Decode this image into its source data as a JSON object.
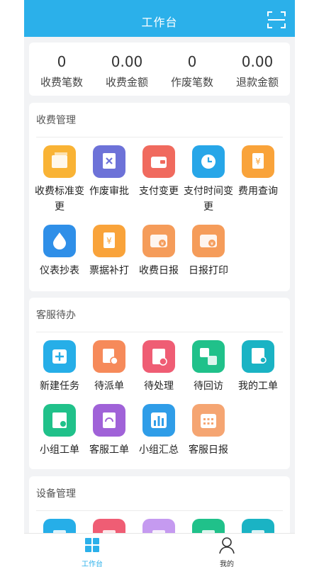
{
  "header": {
    "title": "工作台"
  },
  "stats": [
    {
      "value": "0",
      "label": "收费笔数"
    },
    {
      "value": "0.00",
      "label": "收费金额"
    },
    {
      "value": "0",
      "label": "作废笔数"
    },
    {
      "value": "0.00",
      "label": "退款金额"
    }
  ],
  "sections": [
    {
      "title": "收费管理",
      "items": [
        {
          "label": "收费标准变更",
          "icon": "folder-icon",
          "color": "#f9b335"
        },
        {
          "label": "作废审批",
          "icon": "void-approve-icon",
          "color": "#6d72d8"
        },
        {
          "label": "支付变更",
          "icon": "wallet-icon",
          "color": "#f06a5e"
        },
        {
          "label": "支付时间变更",
          "icon": "clock-icon",
          "color": "#27a6e8"
        },
        {
          "label": "费用查询",
          "icon": "yen-doc-icon",
          "color": "#f9a33a"
        },
        {
          "label": "仪表抄表",
          "icon": "water-drop-icon",
          "color": "#2f8fe8"
        },
        {
          "label": "票据补打",
          "icon": "yen-receipt-icon",
          "color": "#f9a33a"
        },
        {
          "label": "收费日报",
          "icon": "yen-card-icon",
          "color": "#f59c5a"
        },
        {
          "label": "日报打印",
          "icon": "yen-card-icon",
          "color": "#f59c5a"
        }
      ]
    },
    {
      "title": "客服待办",
      "items": [
        {
          "label": "新建任务",
          "icon": "plus-icon",
          "color": "#26aee8"
        },
        {
          "label": "待派单",
          "icon": "dispatch-icon",
          "color": "#f68a5a"
        },
        {
          "label": "待处理",
          "icon": "clipboard-alert-icon",
          "color": "#ef5d74"
        },
        {
          "label": "待回访",
          "icon": "blocks-icon",
          "color": "#20c18a"
        },
        {
          "label": "我的工单",
          "icon": "user-doc-icon",
          "color": "#1ab3c4"
        },
        {
          "label": "小组工单",
          "icon": "group-doc-icon",
          "color": "#20c18a"
        },
        {
          "label": "客服工单",
          "icon": "headset-icon",
          "color": "#a062d8"
        },
        {
          "label": "小组汇总",
          "icon": "bar-chart-icon",
          "color": "#2f9de8"
        },
        {
          "label": "客服日报",
          "icon": "calendar-icon",
          "color": "#f5a572"
        }
      ]
    },
    {
      "title": "设备管理",
      "items": [
        {
          "label": "",
          "icon": "device-icon",
          "color": "#26aee8"
        },
        {
          "label": "",
          "icon": "device-icon",
          "color": "#ef5d74"
        },
        {
          "label": "",
          "icon": "device-icon",
          "color": "#c59af0"
        },
        {
          "label": "",
          "icon": "device-icon",
          "color": "#20c18a"
        },
        {
          "label": "",
          "icon": "device-icon",
          "color": "#1ab3c4"
        }
      ]
    }
  ],
  "tabs": [
    {
      "label": "工作台",
      "active": true,
      "icon": "grid-icon"
    },
    {
      "label": "我的",
      "active": false,
      "icon": "person-icon"
    }
  ],
  "colors": {
    "primary": "#2bb0ea",
    "background": "#f2f3f5"
  }
}
